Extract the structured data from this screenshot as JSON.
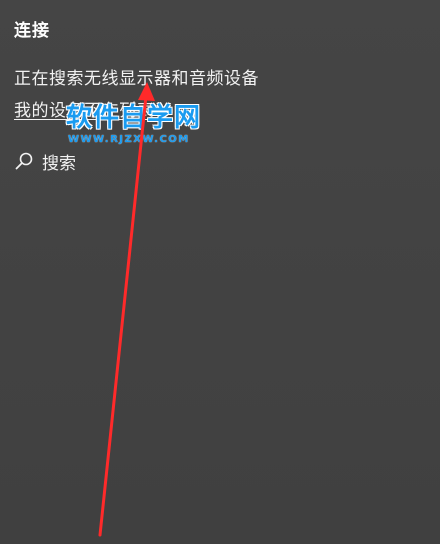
{
  "panel": {
    "title": "连接",
    "status_text": "正在搜索无线显示器和音频设备",
    "link_text": "我的设备不在列表",
    "search_label": "搜索"
  },
  "watermark": {
    "main": "软件自学网",
    "sub": "WWW.RJZXW.COM"
  },
  "colors": {
    "background": "#434343",
    "text": "#ffffff",
    "watermark": "#1a9bf0",
    "annotation_arrow": "#ff2a2a"
  }
}
